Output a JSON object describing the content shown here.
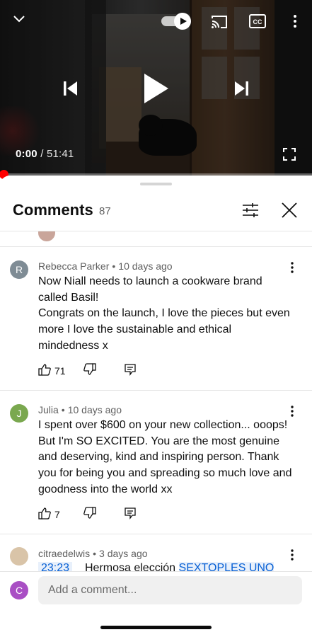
{
  "player": {
    "current_time": "0:00",
    "duration": "/ 51:41",
    "progress": 0.0,
    "icons": {
      "collapse": "chevron-down-icon",
      "autoplay": "autoplay-toggle-icon",
      "cast": "cast-icon",
      "captions": "closed-captions-icon",
      "more": "more-vertical-icon",
      "previous": "skip-previous-icon",
      "play": "play-icon",
      "next": "skip-next-icon",
      "fullscreen": "fullscreen-icon"
    },
    "colors": {
      "progress": "#ff0000"
    }
  },
  "comments_panel": {
    "title": "Comments",
    "count": "87",
    "icons": {
      "filter": "sliders-icon",
      "close": "close-icon"
    },
    "comments": [
      {
        "avatar_letter": "R",
        "avatar_color": "#7f8c95",
        "author": "Rebecca Parker",
        "time": "10 days ago",
        "text": "Now Niall needs to launch a cookware brand called Basil!\nCongrats on the launch, I love the pieces but even more I love the sustainable and ethical mindedness x",
        "likes": "71"
      },
      {
        "avatar_letter": "J",
        "avatar_color": "#7aa84f",
        "author": "Julia",
        "time": "10 days ago",
        "text": "I spent over $600 on your new collection... ooops! But I'm SO EXCITED. You are the most genuine and deserving, kind and inspiring person. Thank you for being you and spreading so much love and goodness into the world xx",
        "likes": "7"
      },
      {
        "author": "citraedelwis",
        "time": "3 days ago",
        "timestamp_link": "23:23",
        "text_start": "Hermosa elección",
        "text_link": "SEXTOPLES UNO"
      }
    ]
  },
  "composer": {
    "avatar_letter": "C",
    "placeholder": "Add a comment..."
  }
}
